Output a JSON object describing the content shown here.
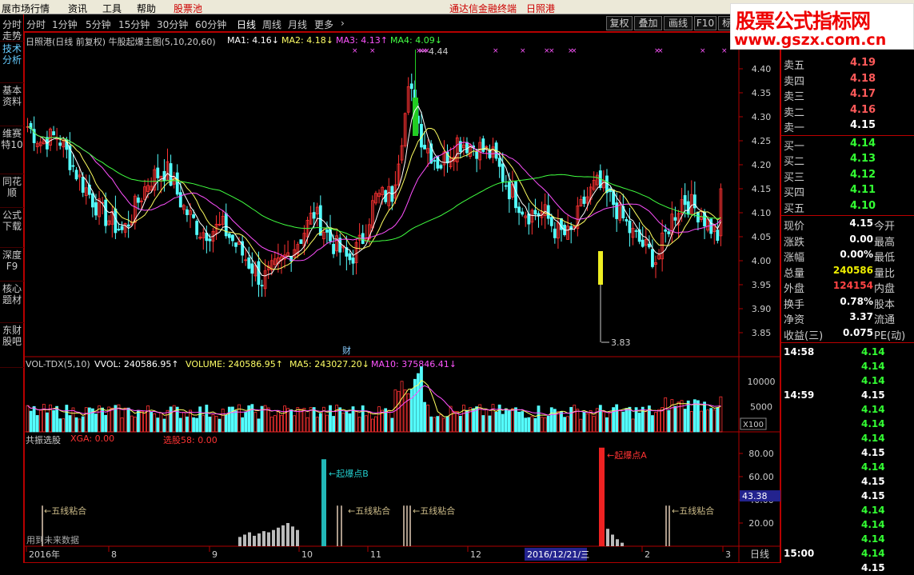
{
  "menubar": {
    "items": [
      "展市场行情",
      "资讯",
      "工具",
      "帮助",
      "股票池"
    ],
    "center_link": "通达信金融终端",
    "stock_name": "日照港"
  },
  "brand": {
    "line1": "股票公式指标网",
    "line2": "www.gszx.com.cn"
  },
  "left_tabs": [
    "分时走势",
    "技术分析",
    "基本资料",
    "维赛特10",
    "同花顺",
    "公式下载",
    "深度F9",
    "核心题材",
    "东财股吧"
  ],
  "periods": [
    "分时",
    "1分钟",
    "5分钟",
    "15分钟",
    "30分钟",
    "60分钟",
    "日线",
    "周线",
    "月线",
    "更多"
  ],
  "active_period": "日线",
  "toolbar": [
    "复权",
    "叠加",
    "画线",
    "F10",
    "标"
  ],
  "main": {
    "title": "日照港(日线 前复权) 牛股起爆主图(5,10,20,60)",
    "ma1": "MA1: 4.16↓",
    "ma2": "MA2: 4.18↓",
    "ma3": "MA3: 4.13↑",
    "ma4": "MA4: 4.09↓",
    "high_label": "4.44",
    "low_label": "3.83",
    "cai": "财",
    "yticks": [
      "4.40",
      "4.35",
      "4.30",
      "4.25",
      "4.20",
      "4.15",
      "4.10",
      "4.05",
      "4.00",
      "3.95",
      "3.90",
      "3.85"
    ]
  },
  "vol": {
    "title": "VOL-TDX(5,10)",
    "vvol": "VVOL: 240586.95↑",
    "volume": "VOLUME: 240586.95↑",
    "ma5": "MA5: 243027.20↓",
    "ma10": "MA10: 375846.41↓",
    "yticks": [
      "10000",
      "5000"
    ],
    "unit": "X100"
  },
  "ind": {
    "title": "共振选股",
    "xga": "XGA: 0.00",
    "xg58": "选股58: 0.00",
    "yticks": [
      "80.00",
      "60.00",
      "40.00",
      "20.00"
    ],
    "current": "43.38",
    "labels": {
      "qibao1": "起爆点B",
      "qibao2": "起爆点A",
      "wx": "五线粘合"
    },
    "future": "用到未来数据"
  },
  "xaxis": {
    "labels": [
      "2016年",
      "8",
      "9",
      "10",
      "11",
      "12",
      "2",
      "3"
    ],
    "cursor": "2016/12/21/三",
    "period": "日线"
  },
  "quote": {
    "sells": [
      {
        "l": "卖五",
        "p": "4.19"
      },
      {
        "l": "卖四",
        "p": "4.18"
      },
      {
        "l": "卖三",
        "p": "4.17"
      },
      {
        "l": "卖二",
        "p": "4.16"
      },
      {
        "l": "卖一",
        "p": "4.15"
      }
    ],
    "buys": [
      {
        "l": "买一",
        "p": "4.14"
      },
      {
        "l": "买二",
        "p": "4.13"
      },
      {
        "l": "买三",
        "p": "4.12"
      },
      {
        "l": "买四",
        "p": "4.11"
      },
      {
        "l": "买五",
        "p": "4.10"
      }
    ],
    "stats": [
      {
        "l": "现价",
        "v": "4.15",
        "r": "今开"
      },
      {
        "l": "涨跌",
        "v": "0.00",
        "r": "最高"
      },
      {
        "l": "涨幅",
        "v": "0.00%",
        "r": "最低"
      },
      {
        "l": "总量",
        "v": "240586",
        "r": "量比"
      },
      {
        "l": "外盘",
        "v": "124154",
        "r": "内盘"
      },
      {
        "l": "换手",
        "v": "0.78%",
        "r": "股本"
      },
      {
        "l": "净资",
        "v": "3.37",
        "r": "流通"
      },
      {
        "l": "收益(三)",
        "v": "0.075",
        "r": "PE(动)"
      }
    ]
  },
  "ticks": [
    {
      "t": "14:58",
      "p": "4.14"
    },
    {
      "t": "",
      "p": "4.14"
    },
    {
      "t": "",
      "p": "4.14"
    },
    {
      "t": "14:59",
      "p": "4.15"
    },
    {
      "t": "",
      "p": "4.14"
    },
    {
      "t": "",
      "p": "4.14"
    },
    {
      "t": "",
      "p": "4.14"
    },
    {
      "t": "",
      "p": "4.15"
    },
    {
      "t": "",
      "p": "4.14"
    },
    {
      "t": "",
      "p": "4.15"
    },
    {
      "t": "",
      "p": "4.15"
    },
    {
      "t": "",
      "p": "4.14"
    },
    {
      "t": "",
      "p": "4.14"
    },
    {
      "t": "",
      "p": "4.14"
    },
    {
      "t": "15:00",
      "p": "4.14"
    },
    {
      "t": "",
      "p": "4.15"
    }
  ],
  "colors": {
    "up": "#ff3232",
    "down": "#54ffff",
    "ma1": "#ffffff",
    "ma2": "#ffff60",
    "ma3": "#ff50ff",
    "ma4": "#40ff40",
    "border": "#b00000",
    "green": "#00e000"
  }
}
